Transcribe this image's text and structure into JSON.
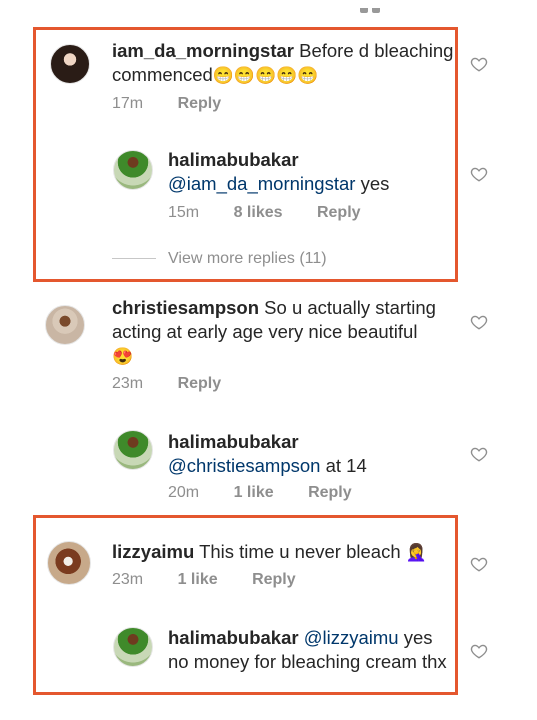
{
  "comments": [
    {
      "username": "iam_da_morningstar",
      "text": "Before d bleaching commenced",
      "emoji": "😁😁😁😁😁",
      "time": "17m",
      "reply_label": "Reply",
      "reply": {
        "username": "halimabubakar",
        "mention": "@iam_da_morningstar",
        "text": "yes",
        "time": "15m",
        "likes": "8 likes",
        "reply_label": "Reply"
      },
      "view_more": "View more replies (11)"
    },
    {
      "username": "christiesampson",
      "text": "So u actually starting acting at early age very nice beautiful",
      "emoji": "😍",
      "time": "23m",
      "reply_label": "Reply",
      "reply": {
        "username": "halimabubakar",
        "mention": "@christiesampson",
        "text": "at 14",
        "time": "20m",
        "likes": "1 like",
        "reply_label": "Reply"
      }
    },
    {
      "username": "lizzyaimu",
      "text": "This time u never bleach",
      "emoji": "🤦‍♀️",
      "time": "23m",
      "likes": "1 like",
      "reply_label": "Reply",
      "reply": {
        "username": "halimabubakar",
        "mention": "@lizzyaimu",
        "text": "yes no money for bleaching cream thx"
      }
    }
  ],
  "icons": {
    "like": "heart-outline-icon"
  },
  "colors": {
    "highlight": "#e4572e",
    "mention": "#00376b",
    "meta": "#8e8e8e"
  }
}
